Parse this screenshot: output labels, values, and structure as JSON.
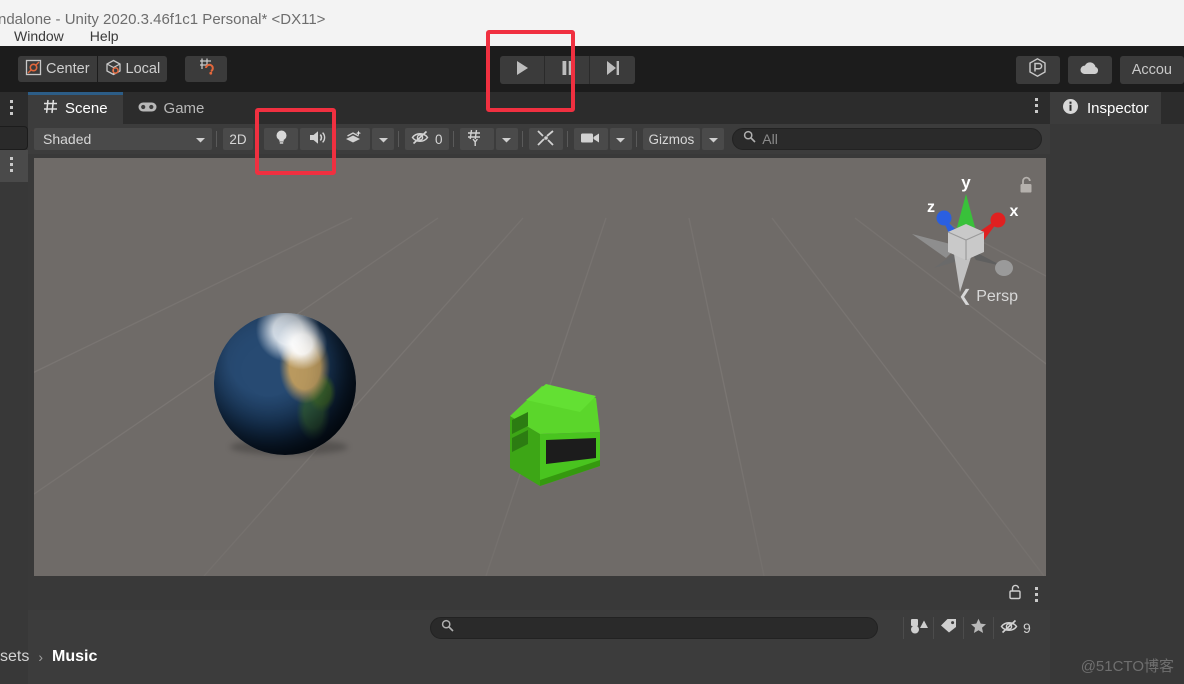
{
  "window": {
    "title": "ndalone - Unity 2020.3.46f1c1 Personal* <DX11>",
    "menu": [
      {
        "label": "Window",
        "name": "menu-window"
      },
      {
        "label": "Help",
        "name": "menu-help"
      }
    ]
  },
  "toolbar": {
    "pivot_mode": "Center",
    "pivot_rotation": "Local",
    "snap_icon": "grid-snap-icon",
    "play_label": "play-icon",
    "pause_label": "pause-icon",
    "step_label": "step-icon",
    "services_icon": "unity-services-icon",
    "cloud_icon": "cloud-icon",
    "account_label": "Accou"
  },
  "scene_panel": {
    "tabs": [
      {
        "label": "Scene",
        "icon": "grid-hash-icon",
        "active": true
      },
      {
        "label": "Game",
        "icon": "gamepad-icon",
        "active": false
      }
    ],
    "toolbar": {
      "draw_mode": "Shaded",
      "toggle_2d": "2D",
      "lighting_icon": "lightbulb-icon",
      "audio_icon": "speaker-icon",
      "fx_icon": "effects-icon",
      "hidden_count": "0",
      "hidden_icon": "eye-off-icon",
      "grid_icon": "grid-axis-icon",
      "tools_icon": "tools-icon",
      "camera_icon": "camera-icon",
      "gizmos_label": "Gizmos",
      "search_placeholder": "All",
      "search_value": ""
    },
    "viewport": {
      "gizmo": {
        "axis_y": "y",
        "axis_x": "x",
        "axis_z": "z",
        "projection": "Persp",
        "projection_arrow": "❮",
        "lock_icon": "padlock-icon"
      },
      "objects": [
        {
          "name": "earth-globe",
          "type": "sphere",
          "label": "Earth"
        },
        {
          "name": "green-car",
          "type": "mesh",
          "label": "Car"
        }
      ]
    },
    "footer": {
      "lock_icon": "padlock-open-icon",
      "kebab_icon": "kebab-menu-icon"
    }
  },
  "inspector": {
    "tab_label": "Inspector",
    "tab_icon": "info-icon"
  },
  "project_browser": {
    "search_placeholder": "",
    "search_value": "",
    "search_icon": "search-icon",
    "filters": [
      {
        "name": "filter-by-type",
        "icon": "shapes-icon"
      },
      {
        "name": "filter-by-label",
        "icon": "tag-icon"
      },
      {
        "name": "filter-favorites",
        "icon": "star-icon"
      }
    ],
    "hidden_icon": "eye-off-icon",
    "hidden_count": "9",
    "breadcrumb": [
      {
        "label": "sets",
        "current": false
      },
      {
        "label": "Music",
        "current": true
      }
    ],
    "breadcrumb_separator": "›"
  },
  "annotations": [
    {
      "name": "annotation-play-controls",
      "color": "#f03040"
    },
    {
      "name": "annotation-lighting-audio-toggles",
      "color": "#f03040"
    }
  ],
  "watermark": "@51CTO博客",
  "colors": {
    "accent_blue": "#2c5d87",
    "annotation_red": "#f03040",
    "car_green": "#4fd41f",
    "axis_x": "#e02020",
    "axis_y": "#2ec72e",
    "axis_z": "#2a5fe0"
  }
}
